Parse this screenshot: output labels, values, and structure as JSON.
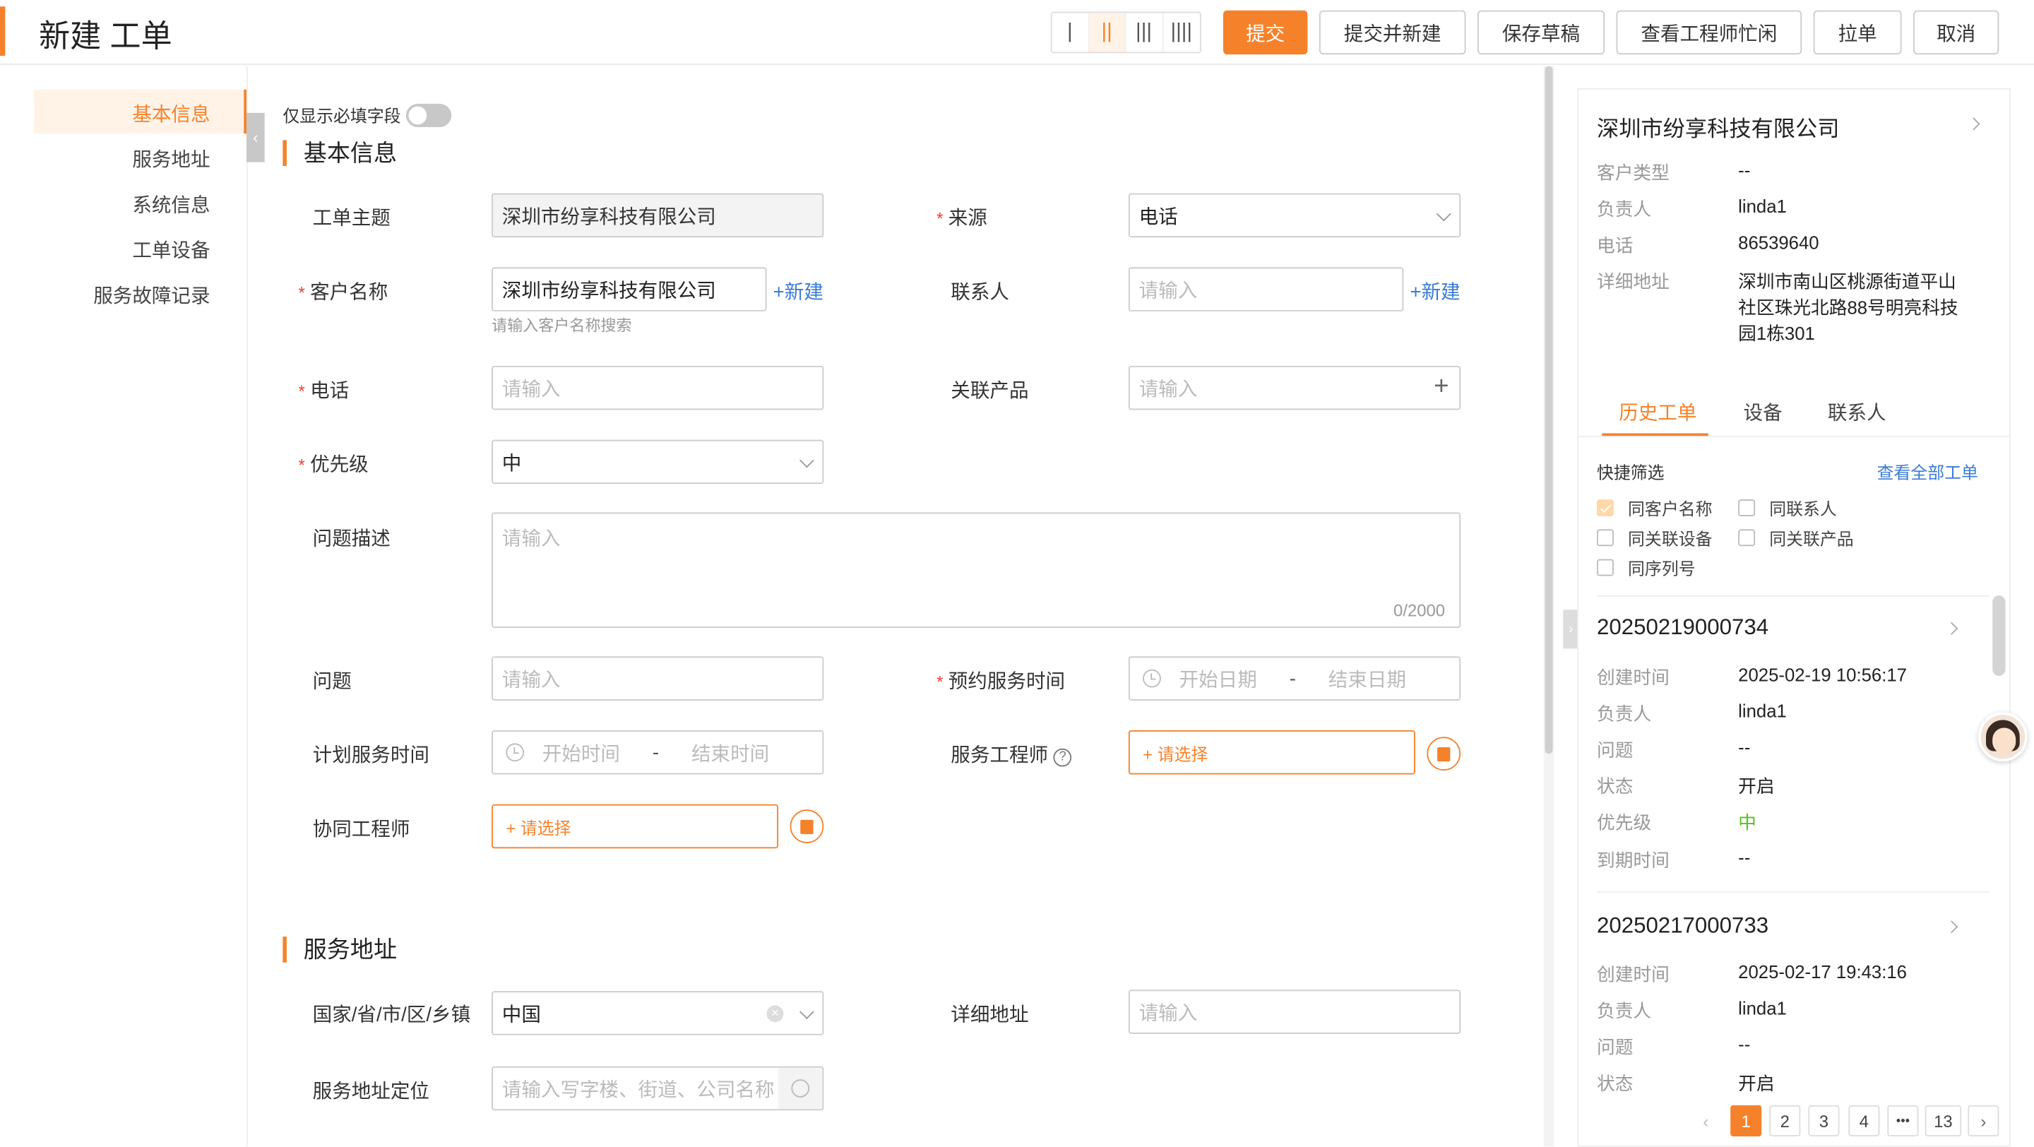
{
  "header": {
    "title": "新建 工单",
    "layout_options": [
      "|",
      "||",
      "|||",
      "||||"
    ],
    "buttons": {
      "submit": "提交",
      "submit_new": "提交并新建",
      "save_draft": "保存草稿",
      "engineer_busy": "查看工程师忙闲",
      "pull": "拉单",
      "cancel": "取消"
    }
  },
  "sidebar": {
    "items": [
      {
        "label": "基本信息"
      },
      {
        "label": "服务地址"
      },
      {
        "label": "系统信息"
      },
      {
        "label": "工单设备"
      },
      {
        "label": "服务故障记录"
      }
    ]
  },
  "form": {
    "required_toggle_label": "仅显示必填字段",
    "section_basic": "基本信息",
    "section_address": "服务地址",
    "subject": {
      "label": "工单主题",
      "value": "深圳市纷享科技有限公司"
    },
    "source": {
      "label": "来源",
      "value": "电话"
    },
    "customer": {
      "label": "客户名称",
      "value": "深圳市纷享科技有限公司",
      "hint": "请输入客户名称搜索",
      "new_link": "+新建"
    },
    "contact": {
      "label": "联系人",
      "placeholder": "请输入",
      "new_link": "+新建"
    },
    "phone": {
      "label": "电话",
      "placeholder": "请输入"
    },
    "product": {
      "label": "关联产品",
      "placeholder": "请输入"
    },
    "priority": {
      "label": "优先级",
      "value": "中"
    },
    "description": {
      "label": "问题描述",
      "placeholder": "请输入",
      "counter": "0/2000"
    },
    "problem": {
      "label": "问题",
      "placeholder": "请输入"
    },
    "appointment": {
      "label": "预约服务时间",
      "start": "开始日期",
      "sep": "-",
      "end": "结束日期"
    },
    "plan_time": {
      "label": "计划服务时间",
      "start": "开始时间",
      "sep": "-",
      "end": "结束时间"
    },
    "engineer": {
      "label": "服务工程师",
      "select": "+ 请选择"
    },
    "co_engineer": {
      "label": "协同工程师",
      "select": "+ 请选择"
    },
    "region": {
      "label": "国家/省/市/区/乡镇",
      "value": "中国"
    },
    "address": {
      "label": "详细地址",
      "placeholder": "请输入"
    },
    "location": {
      "label": "服务地址定位",
      "placeholder": "请输入写字楼、街道、公司名称"
    }
  },
  "panel": {
    "company": "深圳市纷享科技有限公司",
    "info": [
      {
        "label": "客户类型",
        "value": "--"
      },
      {
        "label": "负责人",
        "value": "linda1"
      },
      {
        "label": "电话",
        "value": "86539640"
      },
      {
        "label": "详细地址",
        "value_lines": [
          "深圳市南山区桃源街道平山",
          "社区珠光北路88号明亮科技",
          "园1栋301"
        ]
      }
    ],
    "tabs": [
      "历史工单",
      "设备",
      "联系人"
    ],
    "quick_filter_label": "快捷筛选",
    "view_all": "查看全部工单",
    "filters": [
      {
        "label": "同客户名称",
        "checked": true
      },
      {
        "label": "同联系人",
        "checked": false
      },
      {
        "label": "同关联设备",
        "checked": false
      },
      {
        "label": "同关联产品",
        "checked": false
      },
      {
        "label": "同序列号",
        "checked": false
      }
    ],
    "orders": [
      {
        "id": "20250219000734",
        "fields": [
          {
            "label": "创建时间",
            "value": "2025-02-19 10:56:17"
          },
          {
            "label": "负责人",
            "value": "linda1"
          },
          {
            "label": "问题",
            "value": "--"
          },
          {
            "label": "状态",
            "value": "开启"
          },
          {
            "label": "优先级",
            "value": "中"
          },
          {
            "label": "到期时间",
            "value": "--"
          }
        ]
      },
      {
        "id": "20250217000733",
        "fields": [
          {
            "label": "创建时间",
            "value": "2025-02-17 19:43:16"
          },
          {
            "label": "负责人",
            "value": "linda1"
          },
          {
            "label": "问题",
            "value": "--"
          },
          {
            "label": "状态",
            "value": "开启"
          }
        ]
      }
    ],
    "pagination": {
      "pages": [
        "1",
        "2",
        "3",
        "4",
        "•••",
        "13"
      ],
      "current": "1"
    },
    "colors": {
      "accent": "#f5822a",
      "priority_mid": "#52c41a",
      "link": "#3a7bd5"
    }
  }
}
